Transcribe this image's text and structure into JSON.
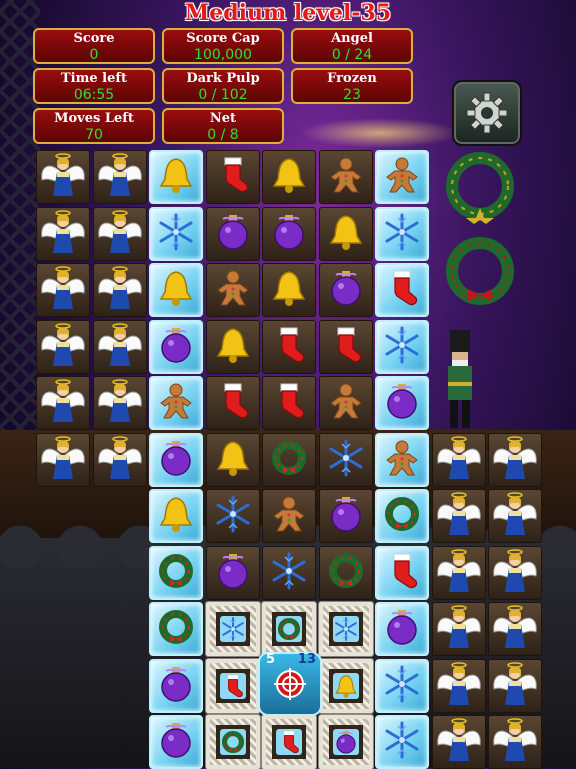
{
  "title": "Medium level-35",
  "stats": {
    "score": {
      "label": "Score",
      "value": "0"
    },
    "score_cap": {
      "label": "Score Cap",
      "value": "100,000"
    },
    "angel": {
      "label": "Angel",
      "value": "0 / 24"
    },
    "time_left": {
      "label": "Time left",
      "value": "06:55"
    },
    "dark_pulp": {
      "label": "Dark Pulp",
      "value": "0 / 102"
    },
    "frozen": {
      "label": "Frozen",
      "value": "23"
    },
    "moves_left": {
      "label": "Moves Left",
      "value": "70"
    },
    "net": {
      "label": "Net",
      "value": "0 / 8"
    }
  },
  "target_counts": {
    "left": "5",
    "right": "13"
  },
  "board": [
    [
      "angel",
      "angel",
      "ice:bell",
      "stocking",
      "bell",
      "gingerbread",
      "ice:gingerbread",
      "",
      ""
    ],
    [
      "angel",
      "angel",
      "ice:snowflake",
      "ornament",
      "ornament",
      "bell",
      "ice:snowflake",
      "",
      ""
    ],
    [
      "angel",
      "angel",
      "ice:bell",
      "gingerbread",
      "bell",
      "ornament",
      "ice:stocking",
      "",
      ""
    ],
    [
      "angel",
      "angel",
      "ice:ornament",
      "bell",
      "stocking",
      "stocking",
      "ice:snowflake",
      "",
      ""
    ],
    [
      "angel",
      "angel",
      "ice:gingerbread",
      "stocking",
      "stocking",
      "gingerbread",
      "ice:ornament",
      "",
      ""
    ],
    [
      "angel",
      "angel",
      "ice:ornament",
      "bell",
      "wreath",
      "snowflake",
      "ice:gingerbread",
      "angel",
      "angel"
    ],
    [
      "",
      "",
      "ice:bell",
      "snowflake",
      "gingerbread",
      "ornament",
      "ice:wreath",
      "angel",
      "angel"
    ],
    [
      "",
      "",
      "ice:wreath",
      "ornament",
      "snowflake",
      "wreath",
      "ice:stocking",
      "angel",
      "angel"
    ],
    [
      "",
      "",
      "ice:wreath",
      "rope:snowflake",
      "rope:wreath",
      "rope:snowflake",
      "ice:ornament",
      "angel",
      "angel"
    ],
    [
      "",
      "",
      "ice:ornament",
      "rope:stocking",
      "target",
      "rope:bell",
      "ice:snowflake",
      "angel",
      "angel"
    ],
    [
      "",
      "",
      "ice:ornament",
      "rope:wreath",
      "rope:stocking",
      "rope:ornament",
      "ice:snowflake",
      "angel",
      "angel"
    ]
  ]
}
